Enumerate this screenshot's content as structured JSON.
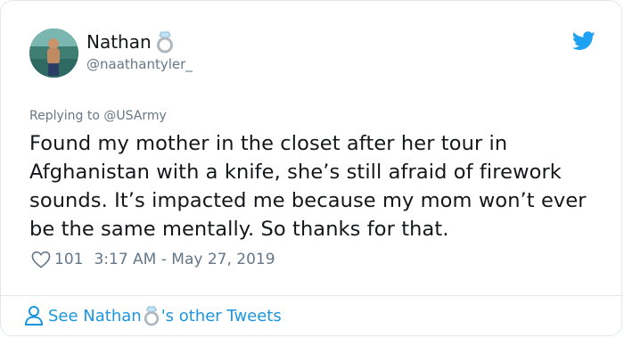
{
  "tweet": {
    "author_name": "Nathan",
    "author_handle": "@naathantyler_",
    "reply_prefix": "Replying to",
    "reply_to": "@USArmy",
    "text": "Found my mother in the closet after her tour in Afghanistan with a knife, she’s still afraid of firework sounds. It’s impacted me because my mom won’t ever be the same mentally. So thanks for that.",
    "likes": "101",
    "timestamp": "3:17 AM - May 27, 2019"
  },
  "footer": {
    "link_prefix": "See Nathan",
    "link_suffix": "'s other Tweets"
  },
  "icons": {
    "ring": "ring-icon",
    "bird": "twitter-bird-icon",
    "heart": "heart-icon",
    "person": "person-icon"
  },
  "colors": {
    "accent": "#1b95e0",
    "text": "#14171a",
    "muted": "#657786",
    "border": "#e1e8ed"
  }
}
